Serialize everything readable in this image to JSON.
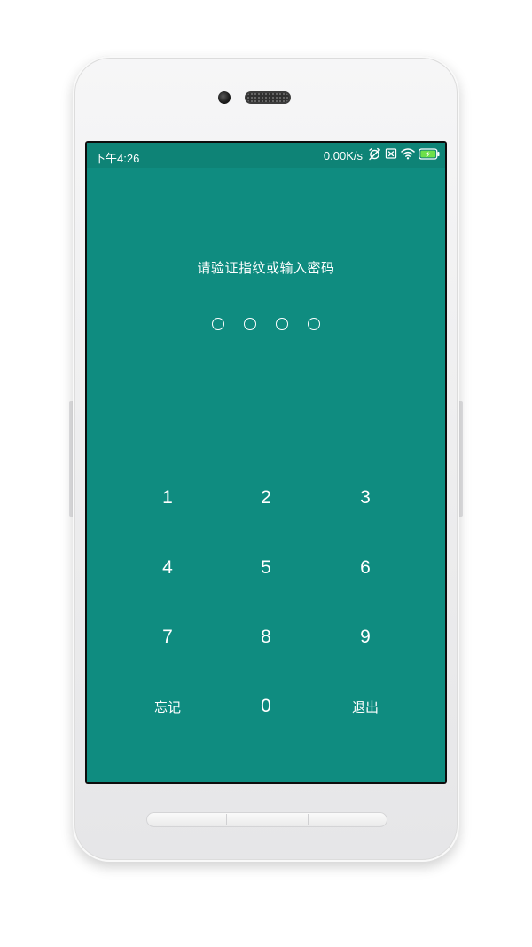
{
  "status_bar": {
    "time": "下午4:26",
    "net_speed": "0.00K/s",
    "icons": [
      "alarm-off-icon",
      "sim-none-icon",
      "wifi-icon",
      "battery-charging-icon"
    ],
    "battery_color": "#6ee04a"
  },
  "lock_screen": {
    "prompt": "请验证指纹或输入密码",
    "pin_length": 4,
    "pin_entered": 0
  },
  "keypad": {
    "keys": [
      "1",
      "2",
      "3",
      "4",
      "5",
      "6",
      "7",
      "8",
      "9"
    ],
    "forgot_label": "忘记",
    "zero": "0",
    "exit_label": "退出"
  },
  "colors": {
    "screen_bg": "#0f8c80",
    "status_bg": "#0e8376",
    "text": "#ffffff"
  }
}
